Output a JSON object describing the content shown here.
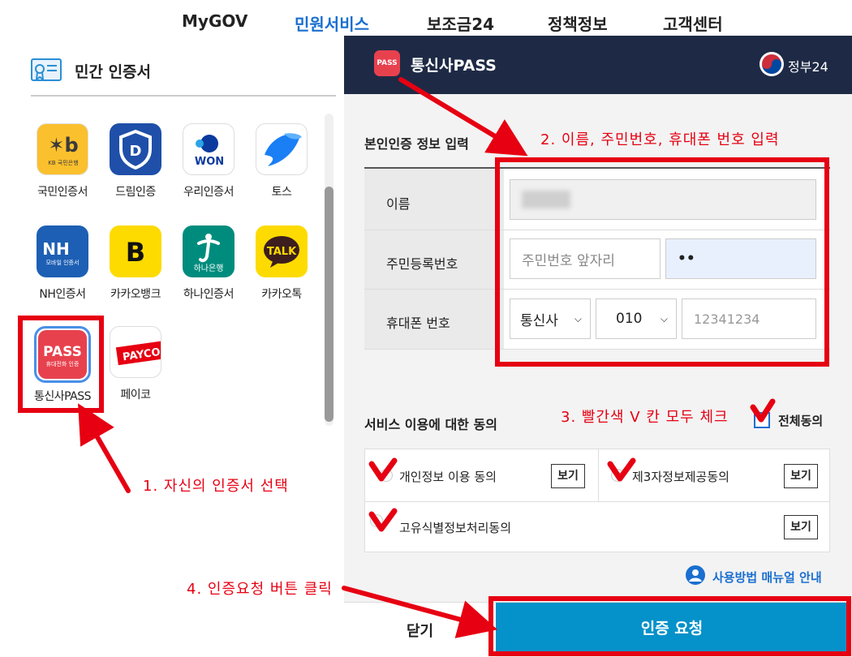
{
  "nav": {
    "items": [
      {
        "label": "MyGOV",
        "active": false
      },
      {
        "label": "민원서비스",
        "active": true
      },
      {
        "label": "보조금24",
        "active": false
      },
      {
        "label": "정책정보",
        "active": false
      },
      {
        "label": "고객센터",
        "active": false
      }
    ]
  },
  "left": {
    "title": "민간 인증서",
    "certs": [
      {
        "label": "국민인증서",
        "logo_text": "KB 국민은행",
        "color": "#fbc02d"
      },
      {
        "label": "드림인증",
        "logo_text": "D",
        "color": "#1f4fa8"
      },
      {
        "label": "우리인증서",
        "logo_text": "WON",
        "color": "#ffffff"
      },
      {
        "label": "토스",
        "logo_text": "",
        "color": "#ffffff"
      },
      {
        "label": "NH인증서",
        "logo_text": "NH",
        "logo_sub": "모바일 인증서",
        "color": "#1d5fb4"
      },
      {
        "label": "카카오뱅크",
        "logo_text": "B",
        "color": "#fddb00"
      },
      {
        "label": "하나인증서",
        "logo_text": "하나은행",
        "color": "#008c7d"
      },
      {
        "label": "카카오톡",
        "logo_text": "TALK",
        "color": "#fddb00"
      },
      {
        "label": "통신사PASS",
        "logo_text": "PASS",
        "logo_sub": "휴대전화 인증",
        "color": "#e8414e"
      },
      {
        "label": "페이코",
        "logo_text": "PAYCO",
        "color": "#ffffff"
      }
    ]
  },
  "modal": {
    "logo_text": "PASS",
    "title": "통신사PASS",
    "gov_text": "정부24",
    "section1_title": "본인인증 정보 입력",
    "fields": {
      "name_label": "이름",
      "rrn_label": "주민등록번호",
      "rrn_front_placeholder": "주민번호 앞자리",
      "rrn_back_value": "••",
      "phone_label": "휴대폰 번호",
      "carrier_value": "통신사",
      "prefix_value": "010",
      "phone_placeholder": "12341234"
    },
    "section2_title": "서비스 이용에 대한 동의",
    "check_all_label": "전체동의",
    "agreements": [
      {
        "label": "개인정보 이용 동의",
        "button": "보기"
      },
      {
        "label": "제3자정보제공동의",
        "button": "보기"
      },
      {
        "label": "고유식별정보처리동의",
        "button": "보기"
      }
    ],
    "manual_link": "사용방법 매뉴얼 안내",
    "close_button": "닫기",
    "request_button": "인증 요청"
  },
  "annotations": {
    "step1": "1. 자신의 인증서 선택",
    "step2": "2. 이름, 주민번호, 휴대폰 번호 입력",
    "step3": "3. 빨간색 V 칸 모두 체크",
    "step4": "4. 인증요청 버튼 클릭",
    "color": "#e60012"
  }
}
